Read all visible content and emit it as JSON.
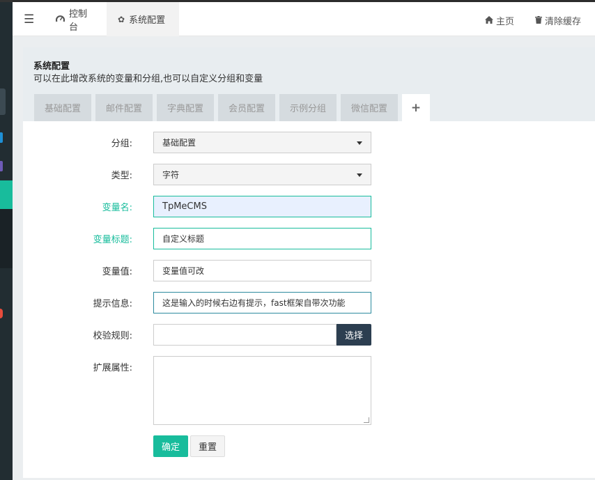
{
  "topbar": {
    "tabs": [
      {
        "icon": "dashboard-icon",
        "label": "控制台"
      },
      {
        "icon": "gear-icon",
        "label": "系统配置"
      }
    ],
    "home_label": "主页",
    "clear_cache_label": "清除缓存"
  },
  "panel": {
    "title": "系统配置",
    "subtitle": "可以在此增改系统的变量和分组,也可以自定义分组和变量",
    "config_tabs": [
      "基础配置",
      "邮件配置",
      "字典配置",
      "会员配置",
      "示例分组",
      "微信配置"
    ],
    "add_tab_symbol": "+"
  },
  "form": {
    "group_label": "分组:",
    "group_value": "基础配置",
    "type_label": "类型:",
    "type_value": "字符",
    "name_label": "变量名:",
    "name_value": "TpMeCMS",
    "title_label": "变量标题:",
    "title_value": "自定义标题",
    "value_label": "变量值:",
    "value_value": "变量值可改",
    "tip_label": "提示信息:",
    "tip_value": "这是输入的时候右边有提示，fast框架自带次功能",
    "rule_label": "校验规则:",
    "rule_value": "",
    "choose_label": "选择",
    "extend_label": "扩展属性:",
    "extend_value": "",
    "submit_label": "确定",
    "reset_label": "重置"
  },
  "colors": {
    "accent": "#18bc9c",
    "dark_button": "#2c3e50",
    "sidebar": "#222d32"
  }
}
